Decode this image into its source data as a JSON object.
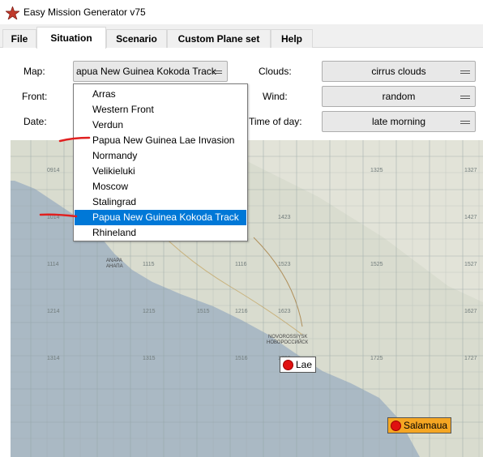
{
  "window": {
    "title": "Easy Mission Generator v75"
  },
  "tabs": [
    {
      "label": "File"
    },
    {
      "label": "Situation"
    },
    {
      "label": "Scenario"
    },
    {
      "label": "Custom Plane set"
    },
    {
      "label": "Help"
    }
  ],
  "form": {
    "map_label": "Map:",
    "map_value": "apua New Guinea Kokoda Track",
    "front_label": "Front:",
    "date_label": "Date:",
    "clouds_label": "Clouds:",
    "clouds_value": "cirrus clouds",
    "wind_label": "Wind:",
    "wind_value": "random",
    "time_label": "Time of day:",
    "time_value": "late morning"
  },
  "map_dropdown": {
    "items": [
      "Arras",
      "Western Front",
      "Verdun",
      "Papua New Guinea Lae Invasion",
      "Normandy",
      "Velikieluki",
      "Moscow",
      "Stalingrad",
      "Papua New Guinea Kokoda Track",
      "Rhineland"
    ],
    "selected": "Papua New Guinea Kokoda Track"
  },
  "map": {
    "grid_labels": [
      "0914",
      "1014",
      "1114",
      "1214",
      "1314",
      "1315",
      "1325",
      "1327",
      "1423",
      "1427",
      "1523",
      "1525",
      "1527",
      "1623",
      "1627",
      "1723",
      "1725",
      "1727",
      "1115",
      "1116",
      "1215",
      "1216",
      "1415",
      "1416",
      "1615",
      "1616",
      "1715",
      "1716",
      "1515",
      "1516",
      "1016"
    ],
    "place_labels": [
      "ANAPA",
      "АНАПА",
      "NOVOROSSIYSK",
      "НОВОРОССИЙСК"
    ],
    "markers": [
      {
        "label": "Lae"
      },
      {
        "label": "Salamaua"
      }
    ]
  },
  "colors": {
    "selection": "#0078d7",
    "marker_dot": "#e01010",
    "salamaua_bg": "#f5a623",
    "annotation": "#e02020"
  }
}
